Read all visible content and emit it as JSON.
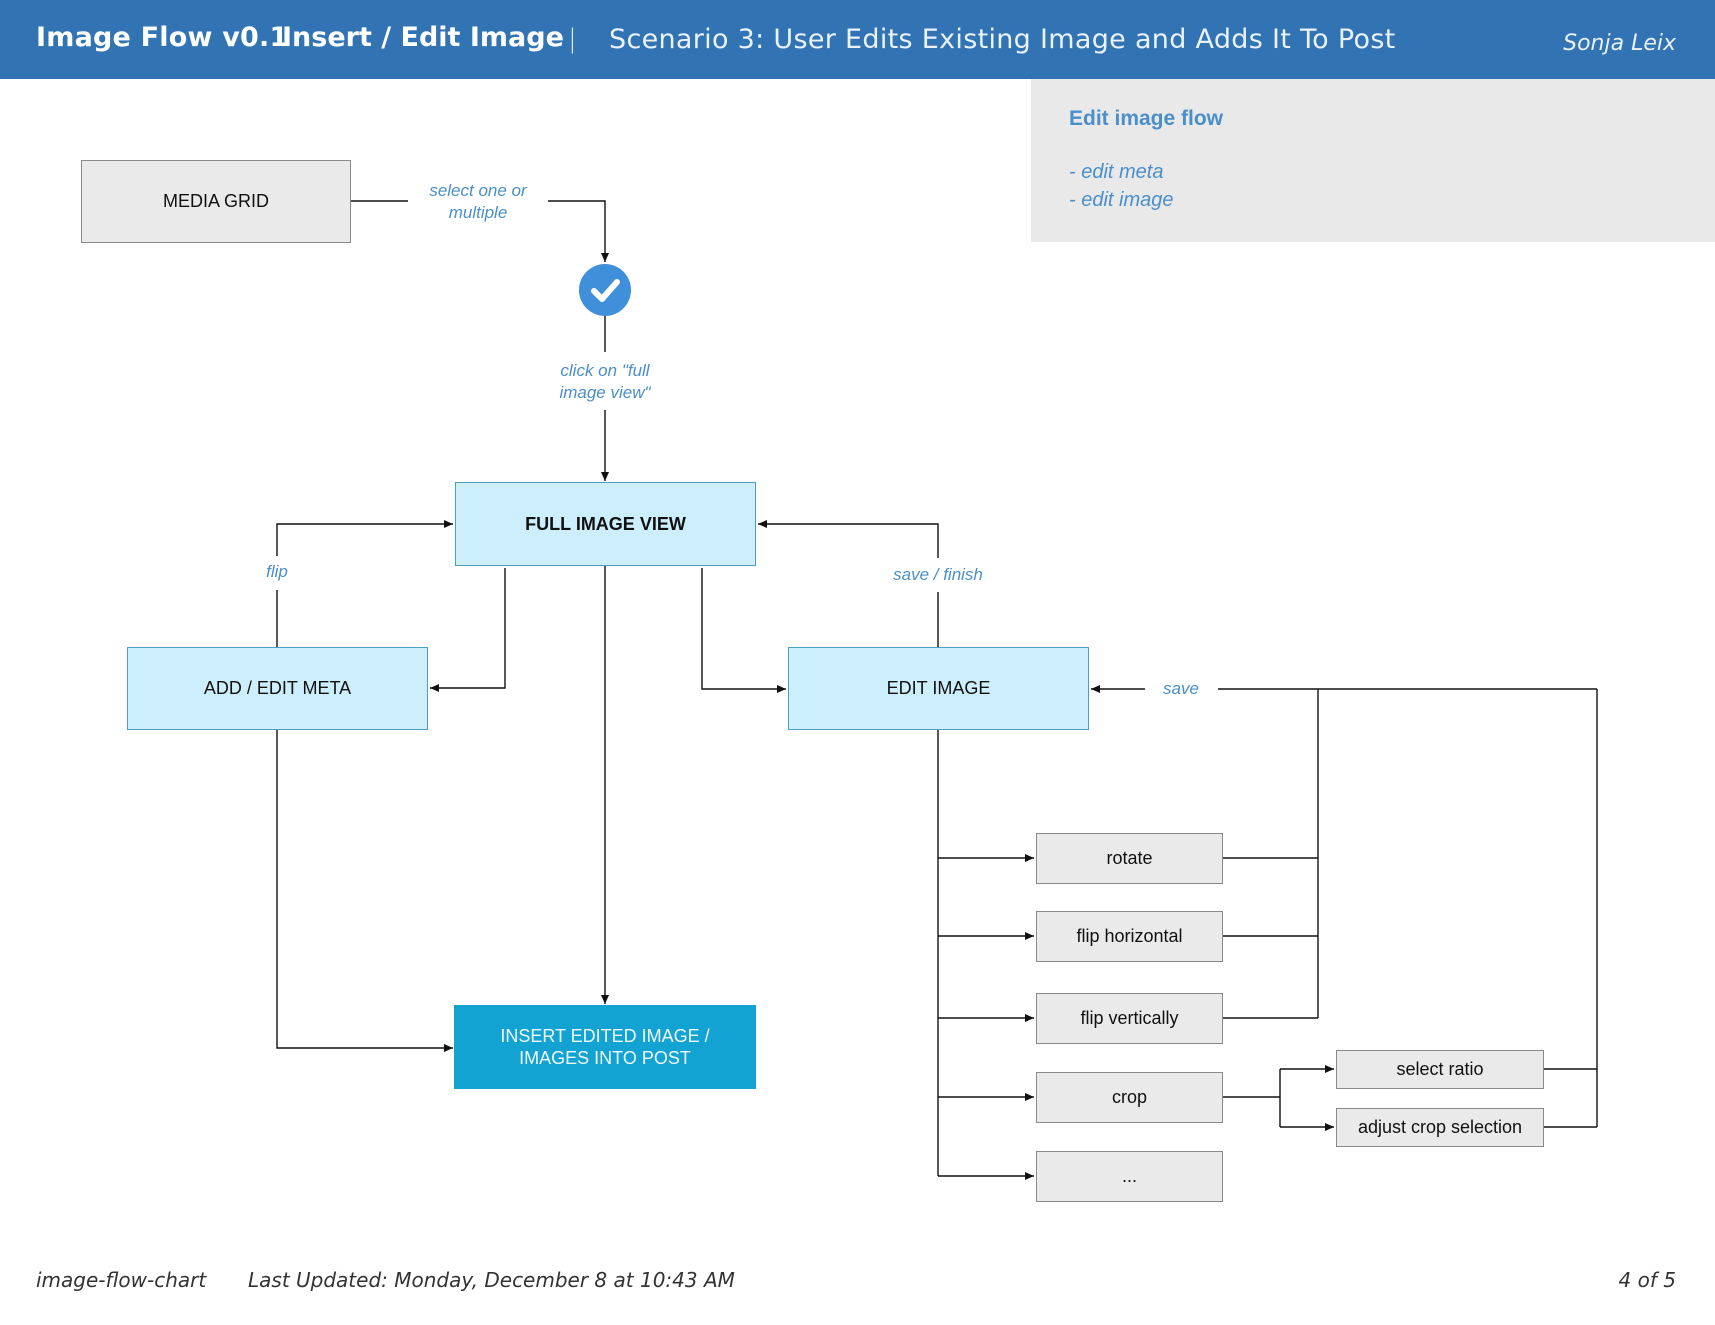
{
  "header": {
    "app_title": "Image Flow v0.1",
    "section_title": "Insert / Edit Image",
    "separator": "|",
    "scenario": "Scenario 3: User Edits Existing Image and Adds It To Post",
    "author": "Sonja Leix",
    "background_color": "#3173b3"
  },
  "notes_panel": {
    "title": "Edit image flow",
    "items": [
      "- edit meta",
      "- edit image"
    ]
  },
  "nodes": {
    "media_grid": "MEDIA GRID",
    "full_image_view": "FULL IMAGE VIEW",
    "add_edit_meta": "ADD / EDIT META",
    "edit_image": "EDIT IMAGE",
    "insert_line1": "INSERT EDITED IMAGE /",
    "insert_line2": "IMAGES INTO POST",
    "rotate": "rotate",
    "flip_horizontal": "flip horizontal",
    "flip_vertically": "flip vertically",
    "crop": "crop",
    "more": "...",
    "select_ratio": "select ratio",
    "adjust_crop_selection": "adjust crop selection"
  },
  "edge_labels": {
    "select_line1": "select one or",
    "select_line2": "multiple",
    "click_line1": "click on \"full",
    "click_line2": "image view\"",
    "flip": "flip",
    "save_finish": "save / finish",
    "save": "save"
  },
  "icons": {
    "selection": "checkmark-circle-icon"
  },
  "colors": {
    "node_grey": "#eaeaea",
    "node_light_blue": "#cdeefc",
    "node_dark_blue": "#12a3d3",
    "label_blue": "#4a8fca",
    "check_blue": "#3f8fda"
  },
  "footer": {
    "doc_name": "image-flow-chart",
    "last_updated": "Last Updated: Monday, December 8 at 10:43 AM",
    "page": "4 of 5"
  }
}
